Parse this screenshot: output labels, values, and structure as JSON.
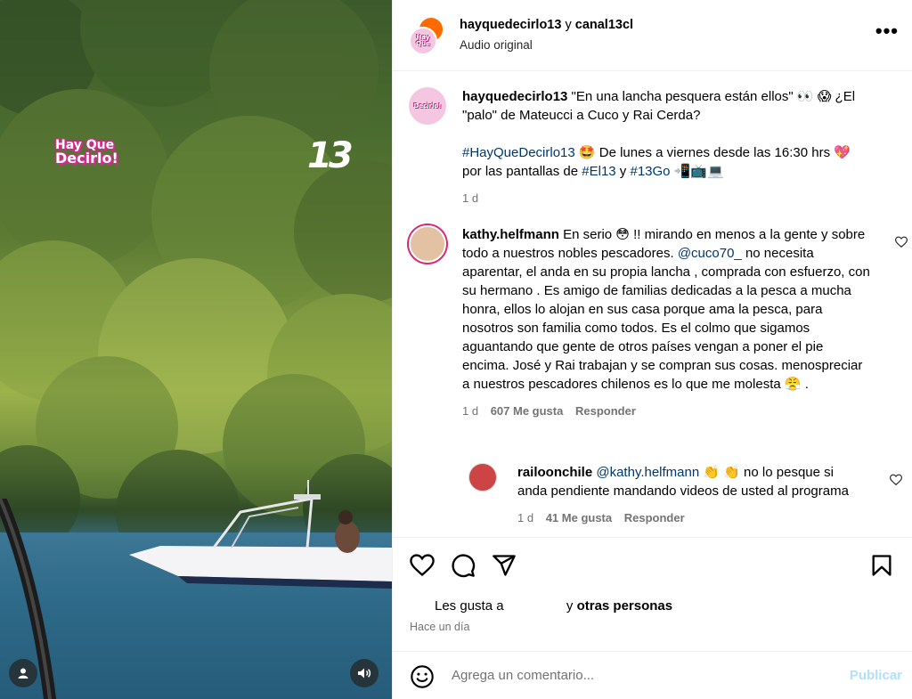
{
  "media": {
    "overlay_logo_left_line1": "Hay Que",
    "overlay_logo_left_line2": "Decirlo!",
    "overlay_logo_right": "13"
  },
  "header": {
    "account_1": "hayquedecirlo13",
    "joiner": "y",
    "account_2": "canal13cl",
    "subtitle": "Audio original",
    "more": "•••"
  },
  "caption": {
    "username": "hayquedecirlo13",
    "text_p1": " \"En una lancha pesquera están ellos\" 👀 😱 ¿El \"palo\" de Mateucci a Cuco y Rai Cerda?",
    "hashtag_1": "#HayQueDecirlo13",
    "text_p2": " 🤩 De lunes a viernes desde las 16:30 hrs 💖 por las pantallas de ",
    "hashtag_2": "#El13",
    "text_p3": " y ",
    "hashtag_3": "#13Go",
    "text_p4": " 📲📺💻",
    "time": "1 d"
  },
  "comments": [
    {
      "username": "kathy.helfmann",
      "text_p1": " En serio 😳 !! mirando en menos a la gente y sobre todo a nuestros nobles pescadores. ",
      "mention": "@cuco70_",
      "text_p2": " no necesita aparentar, el anda en su propia lancha , comprada con esfuerzo, con su hermano . Es amigo de familias dedicadas a la pesca a mucha honra, ellos lo alojan en sus casa porque ama la pesca, para nosotros son familia como todos. Es el colmo que sigamos aguantando que gente de otros países vengan a poner el pie encima. José y Rai trabajan y se compran sus cosas. menospreciar a nuestros pescadores chilenos es lo que me molesta 😤 .",
      "time": "1 d",
      "likes": "607 Me gusta",
      "reply": "Responder"
    },
    {
      "username": "railoonchile",
      "mention": "@kathy.helfmann",
      "text_p1": " 👏 👏 no lo pesque si anda pendiente mandando videos de usted al programa",
      "time": "1 d",
      "likes": "41 Me gusta",
      "reply": "Responder"
    }
  ],
  "likes_line": {
    "prefix": "Les gusta a",
    "joiner": "y",
    "others": "otras personas"
  },
  "post_time": "Hace un día",
  "composer": {
    "placeholder": "Agrega un comentario...",
    "publish": "Publicar"
  }
}
